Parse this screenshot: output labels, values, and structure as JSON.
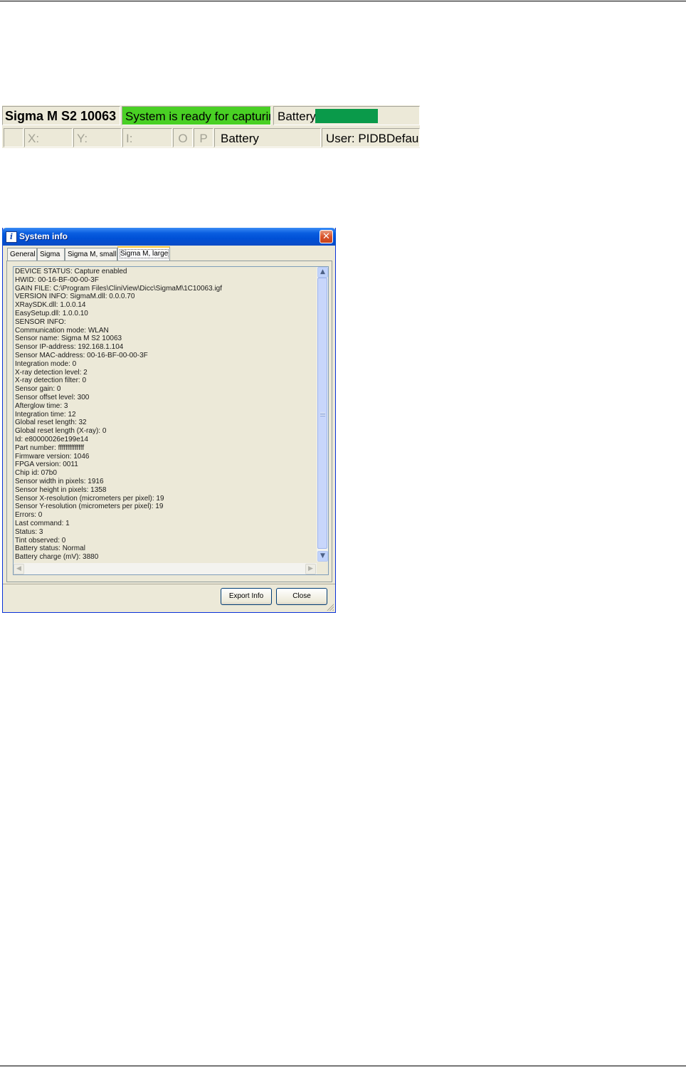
{
  "statusbar": {
    "row1": {
      "device_name": "Sigma M S2 10063",
      "status_text": "System is ready for capturing",
      "battery_label": "Battery",
      "battery_level_percent": 100,
      "status_color": "#49d024",
      "battery_color": "#0a9a4a"
    },
    "row2": {
      "x_label": "X:",
      "y_label": "Y:",
      "i_label": "I:",
      "o_label": "O",
      "p_label": "P",
      "battery_label": "Battery",
      "user_label": "User: PIDBDefault"
    }
  },
  "dialog": {
    "title": "System info",
    "close_icon": "close-icon",
    "tabs": [
      {
        "label": "General"
      },
      {
        "label": "Sigma"
      },
      {
        "label": "Sigma M, small"
      },
      {
        "label": "Sigma M, large"
      }
    ],
    "active_tab": "Sigma M, large",
    "info_lines": [
      "DEVICE STATUS: Capture enabled",
      "HWID: 00-16-BF-00-00-3F",
      "GAIN FILE: C:\\Program Files\\CliniView\\Dicc\\SigmaM\\1C10063.igf",
      "VERSION INFO: SigmaM.dll: 0.0.0.70",
      "XRaySDK.dll: 1.0.0.14",
      "EasySetup.dll: 1.0.0.10",
      "SENSOR INFO:",
      "Communication mode: WLAN",
      "Sensor name: Sigma M S2 10063",
      "Sensor IP-address: 192.168.1.104",
      "Sensor MAC-address: 00-16-BF-00-00-3F",
      "Integration mode: 0",
      "X-ray detection level: 2",
      "X-ray detection filter: 0",
      "Sensor gain: 0",
      "Sensor offset level: 300",
      "Afterglow time: 3",
      "Integration time: 12",
      "Global reset length: 32",
      "Global reset length (X-ray): 0",
      "Id: e80000026e199e14",
      "Part number: ffffffffffffff",
      "Firmware version: 1046",
      "FPGA version: 0011",
      "Chip id: 07b0",
      "Sensor width in pixels: 1916",
      "Sensor height in pixels: 1358",
      "Sensor X-resolution (micrometers per pixel): 19",
      "Sensor Y-resolution (micrometers per pixel): 19",
      "Errors: 0",
      "Last command: 1",
      "Status: 3",
      "Tint observed: 0",
      "Battery status: Normal",
      "Battery charge (mV): 3880"
    ],
    "buttons": {
      "export": "Export Info",
      "close": "Close"
    }
  }
}
